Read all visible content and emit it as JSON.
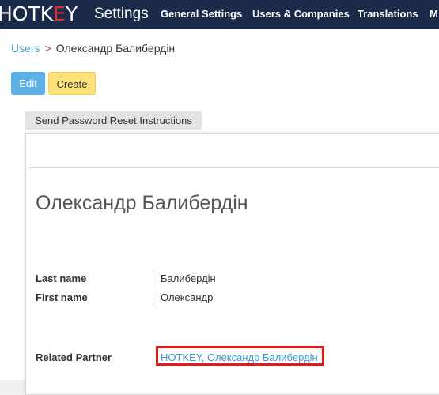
{
  "header": {
    "logo_text_a": "HOTK",
    "logo_text_e": "E",
    "logo_text_b": "Y",
    "app_title": "Settings",
    "menu": [
      "General Settings",
      "Users & Companies",
      "Translations",
      "M"
    ]
  },
  "breadcrumb": {
    "parent": "Users",
    "separator": ">",
    "current": "Олександр Балибердін"
  },
  "actions": {
    "edit": "Edit",
    "create": "Create",
    "reset_password": "Send Password Reset Instructions"
  },
  "record": {
    "name": "Олександр Балибердін",
    "fields": {
      "last_name_label": "Last name",
      "last_name_value": "Балибердін",
      "first_name_label": "First name",
      "first_name_value": "Олександр",
      "partner_label": "Related Partner",
      "partner_value": "HOTKEY, Олександр Балибердін"
    }
  },
  "colors": {
    "topbar": "#1a2a48",
    "link": "#4fa3d1",
    "edit_button": "#5bb0e6",
    "create_button": "#fde27a",
    "highlight": "#e21b1b"
  }
}
